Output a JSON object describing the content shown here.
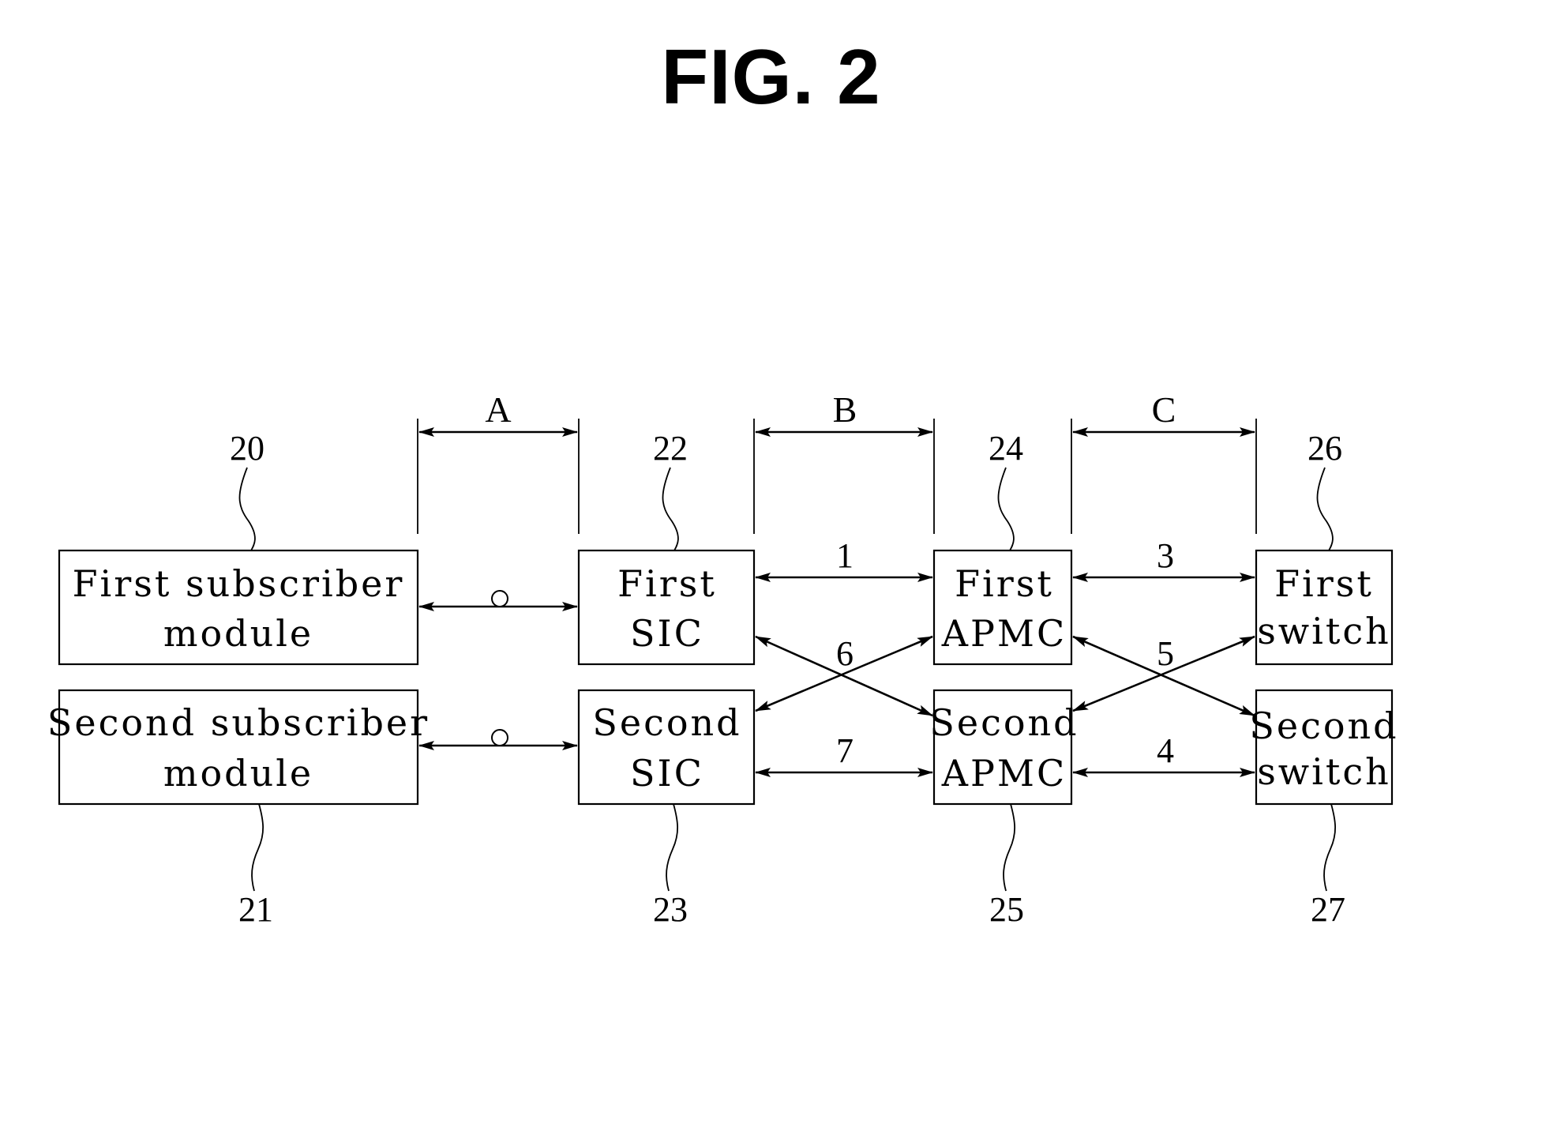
{
  "title": "FIG. 2",
  "blocks": [
    {
      "id": "first-subscriber-module",
      "lines": [
        "First subscriber",
        "module"
      ],
      "ref": "20"
    },
    {
      "id": "second-subscriber-module",
      "lines": [
        "Second subscriber",
        "module"
      ],
      "ref": "21"
    },
    {
      "id": "first-sic",
      "lines": [
        "First",
        "SIC"
      ],
      "ref": "22"
    },
    {
      "id": "second-sic",
      "lines": [
        "Second",
        "SIC"
      ],
      "ref": "23"
    },
    {
      "id": "first-apmc",
      "lines": [
        "First",
        "APMC"
      ],
      "ref": "24"
    },
    {
      "id": "second-apmc",
      "lines": [
        "Second",
        "APMC"
      ],
      "ref": "25"
    },
    {
      "id": "first-switch",
      "lines": [
        "First",
        "switch"
      ],
      "ref": "26"
    },
    {
      "id": "second-switch",
      "lines": [
        "Second",
        "switch"
      ],
      "ref": "27"
    }
  ],
  "sections": [
    "A",
    "B",
    "C"
  ],
  "links": [
    {
      "label": "o",
      "from": "first-subscriber-module",
      "to": "first-sic"
    },
    {
      "label": "o",
      "from": "second-subscriber-module",
      "to": "second-sic"
    },
    {
      "label": "1",
      "from": "first-sic",
      "to": "first-apmc"
    },
    {
      "label": "7",
      "from": "second-sic",
      "to": "second-apmc"
    },
    {
      "label": "6",
      "from": "first-sic/second-sic",
      "to": "second-apmc/first-apmc",
      "crossed": true
    },
    {
      "label": "3",
      "from": "first-apmc",
      "to": "first-switch"
    },
    {
      "label": "4",
      "from": "second-apmc",
      "to": "second-switch"
    },
    {
      "label": "5",
      "from": "first-apmc/second-apmc",
      "to": "second-switch/first-switch",
      "crossed": true
    }
  ]
}
